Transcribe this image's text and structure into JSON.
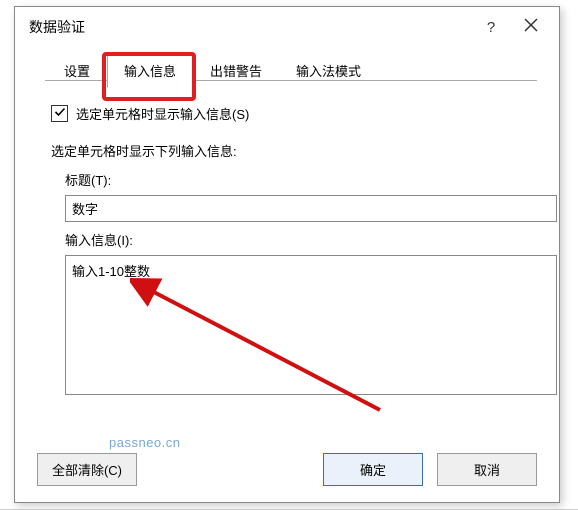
{
  "dialog": {
    "title": "数据验证",
    "help_tooltip": "?",
    "tabs": {
      "settings": "设置",
      "input_message": "输入信息",
      "error_alert": "出错警告",
      "ime_mode": "输入法模式"
    },
    "checkbox_label": "选定单元格时显示输入信息(S)",
    "section_label": "选定单元格时显示下列输入信息:",
    "title_field_label": "标题(T):",
    "title_field_value": "数字",
    "message_field_label": "输入信息(I):",
    "message_field_value": "输入1-10整数",
    "buttons": {
      "clear_all": "全部清除(C)",
      "ok": "确定",
      "cancel": "取消"
    }
  },
  "watermark": "passneo.cn"
}
